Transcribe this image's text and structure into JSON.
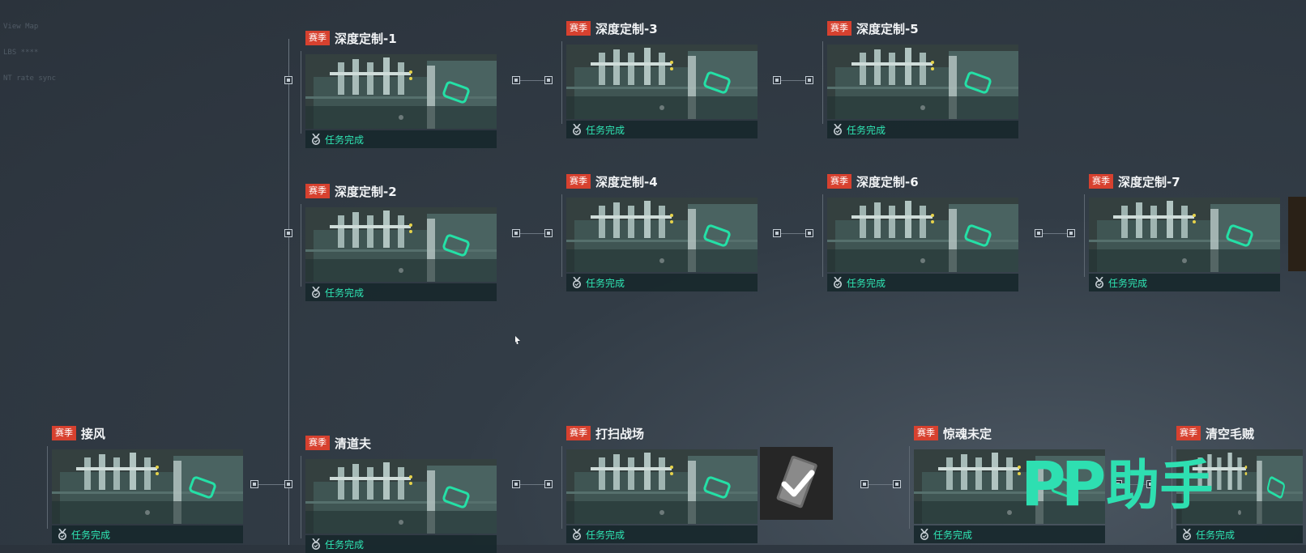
{
  "hud_lines": [
    "View Map",
    "LBS ****",
    "NT     rate sync"
  ],
  "tag_label": "赛季",
  "cards": [
    {
      "id": "c1",
      "title": "深度定制-1",
      "status": "任务完成"
    },
    {
      "id": "c2",
      "title": "深度定制-2",
      "status": "任务完成"
    },
    {
      "id": "c3",
      "title": "深度定制-3",
      "status": "任务完成"
    },
    {
      "id": "c4",
      "title": "深度定制-4",
      "status": "任务完成"
    },
    {
      "id": "c5",
      "title": "深度定制-5",
      "status": "任务完成"
    },
    {
      "id": "c6",
      "title": "深度定制-6",
      "status": "任务完成"
    },
    {
      "id": "c7",
      "title": "深度定制-7",
      "status": "任务完成"
    },
    {
      "id": "b1",
      "title": "接风",
      "status": "任务完成"
    },
    {
      "id": "b2",
      "title": "清道夫",
      "status": "任务完成"
    },
    {
      "id": "b3",
      "title": "打扫战场",
      "status": "任务完成"
    },
    {
      "id": "b4",
      "title": "惊魂未定",
      "status": "任务完成"
    },
    {
      "id": "b5",
      "title": "清空毛贼",
      "status": "任务完成"
    }
  ],
  "watermark": {
    "letters": "PP",
    "text": "助手"
  },
  "colors": {
    "tag": "#d7412f",
    "status": "#2fe6b4",
    "watermark": "#2edfb1"
  },
  "icons": {
    "status": "medal-icon",
    "reward": "checkmark-card-icon"
  }
}
